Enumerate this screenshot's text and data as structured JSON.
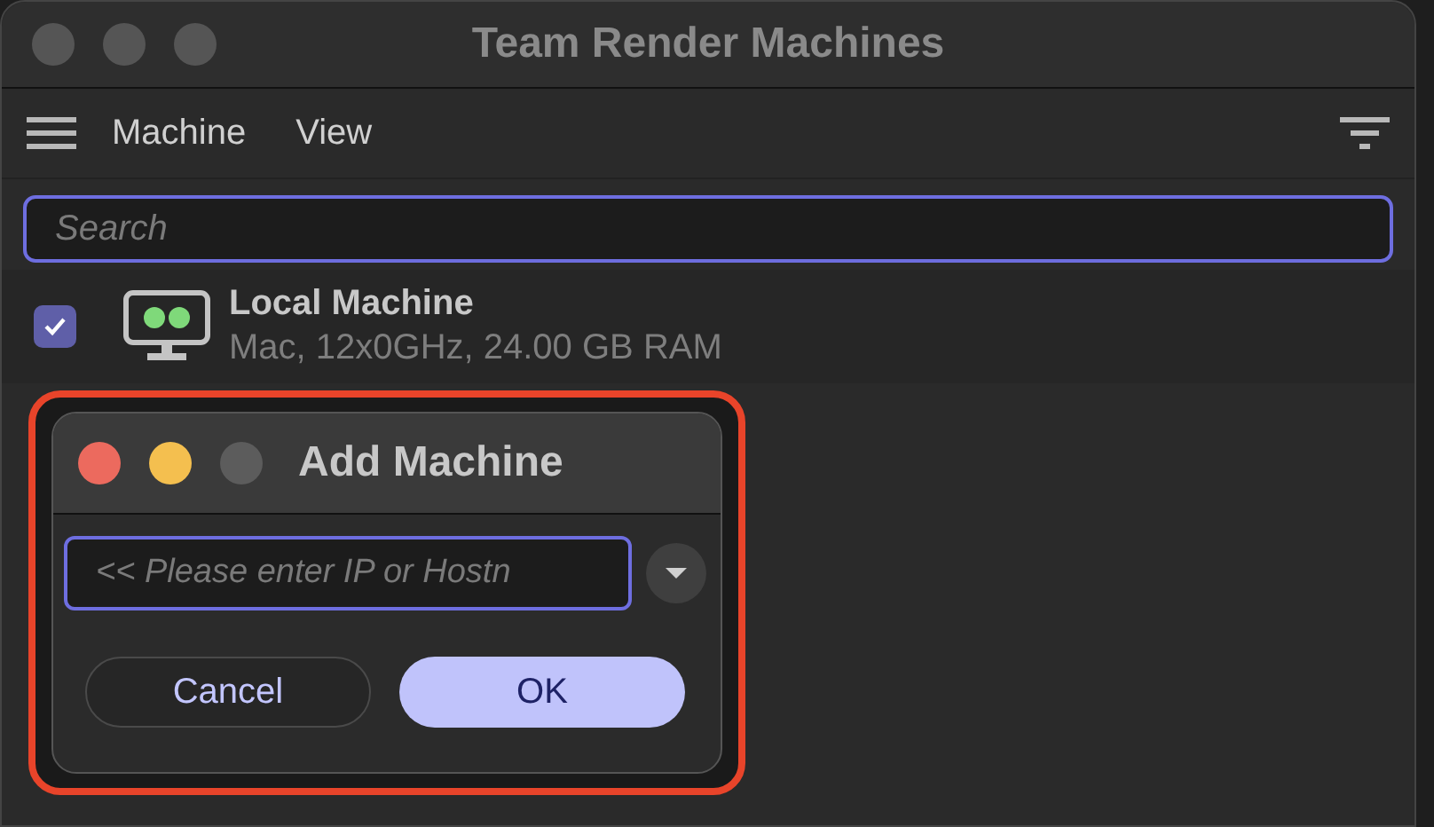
{
  "window": {
    "title": "Team Render Machines"
  },
  "menu": [
    {
      "label": "Machine"
    },
    {
      "label": "View"
    }
  ],
  "search": {
    "placeholder": "Search"
  },
  "machines": [
    {
      "name": "Local Machine",
      "details": "Mac, 12x0GHz, 24.00 GB RAM",
      "checked": true
    }
  ],
  "dialog": {
    "title": "Add Machine",
    "highlighted": true,
    "field": {
      "placeholder": "<< Please enter IP or Hostn"
    },
    "buttons": [
      {
        "label": "Cancel",
        "kind": "secondary"
      },
      {
        "label": "OK",
        "kind": "primary"
      }
    ]
  }
}
